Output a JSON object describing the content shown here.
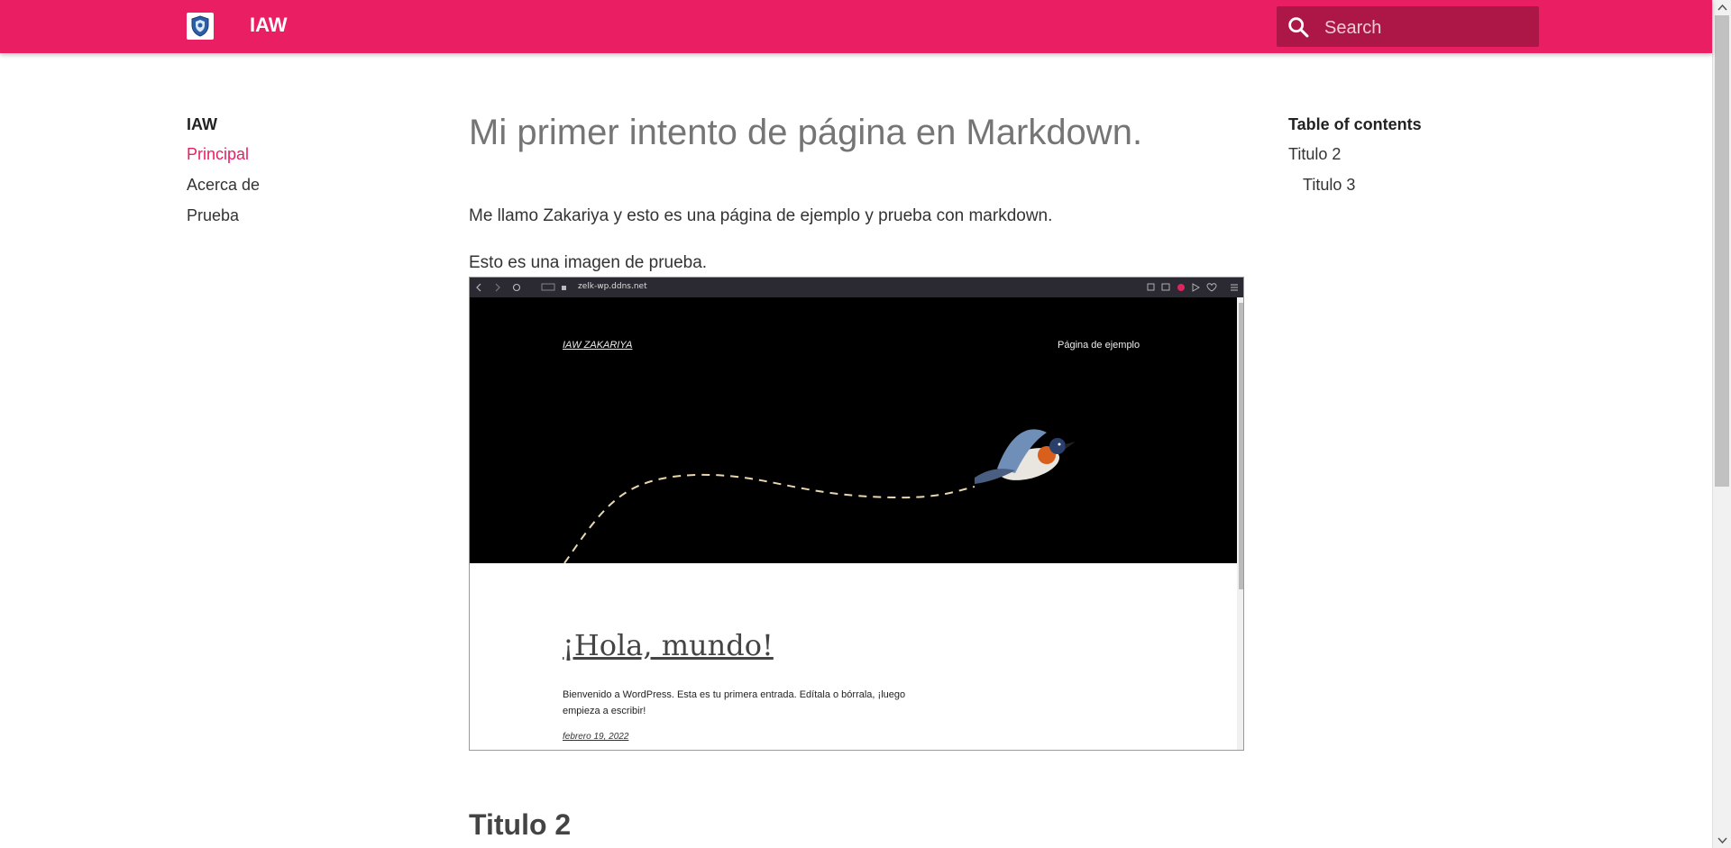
{
  "header": {
    "site_title": "IAW",
    "search_placeholder": "Search",
    "background_color": "#e91e63"
  },
  "nav": {
    "title": "IAW",
    "items": [
      {
        "label": "Principal",
        "active": true
      },
      {
        "label": "Acerca de",
        "active": false
      },
      {
        "label": "Prueba",
        "active": false
      }
    ]
  },
  "toc": {
    "title": "Table of contents",
    "items": [
      {
        "label": "Titulo 2",
        "level": 2
      },
      {
        "label": "Titulo 3",
        "level": 3
      }
    ]
  },
  "content": {
    "title": "Mi primer intento de página en Markdown.",
    "paragraph1": "Me llamo Zakariya y esto es una página de ejemplo y prueba con markdown.",
    "paragraph2": "Esto es una imagen de prueba.",
    "heading2": "Titulo 2"
  },
  "embedded_screenshot": {
    "url": "zelk-wp.ddns.net",
    "site_name": "IAW ZAKARIYA",
    "menu_link": "Página de ejemplo",
    "post_title": "¡Hola, mundo!",
    "post_body": "Bienvenido a WordPress. Esta es tu primera entrada. Edítala o bórrala, ¡luego empieza a escribir!",
    "post_date": "febrero 19, 2022"
  }
}
